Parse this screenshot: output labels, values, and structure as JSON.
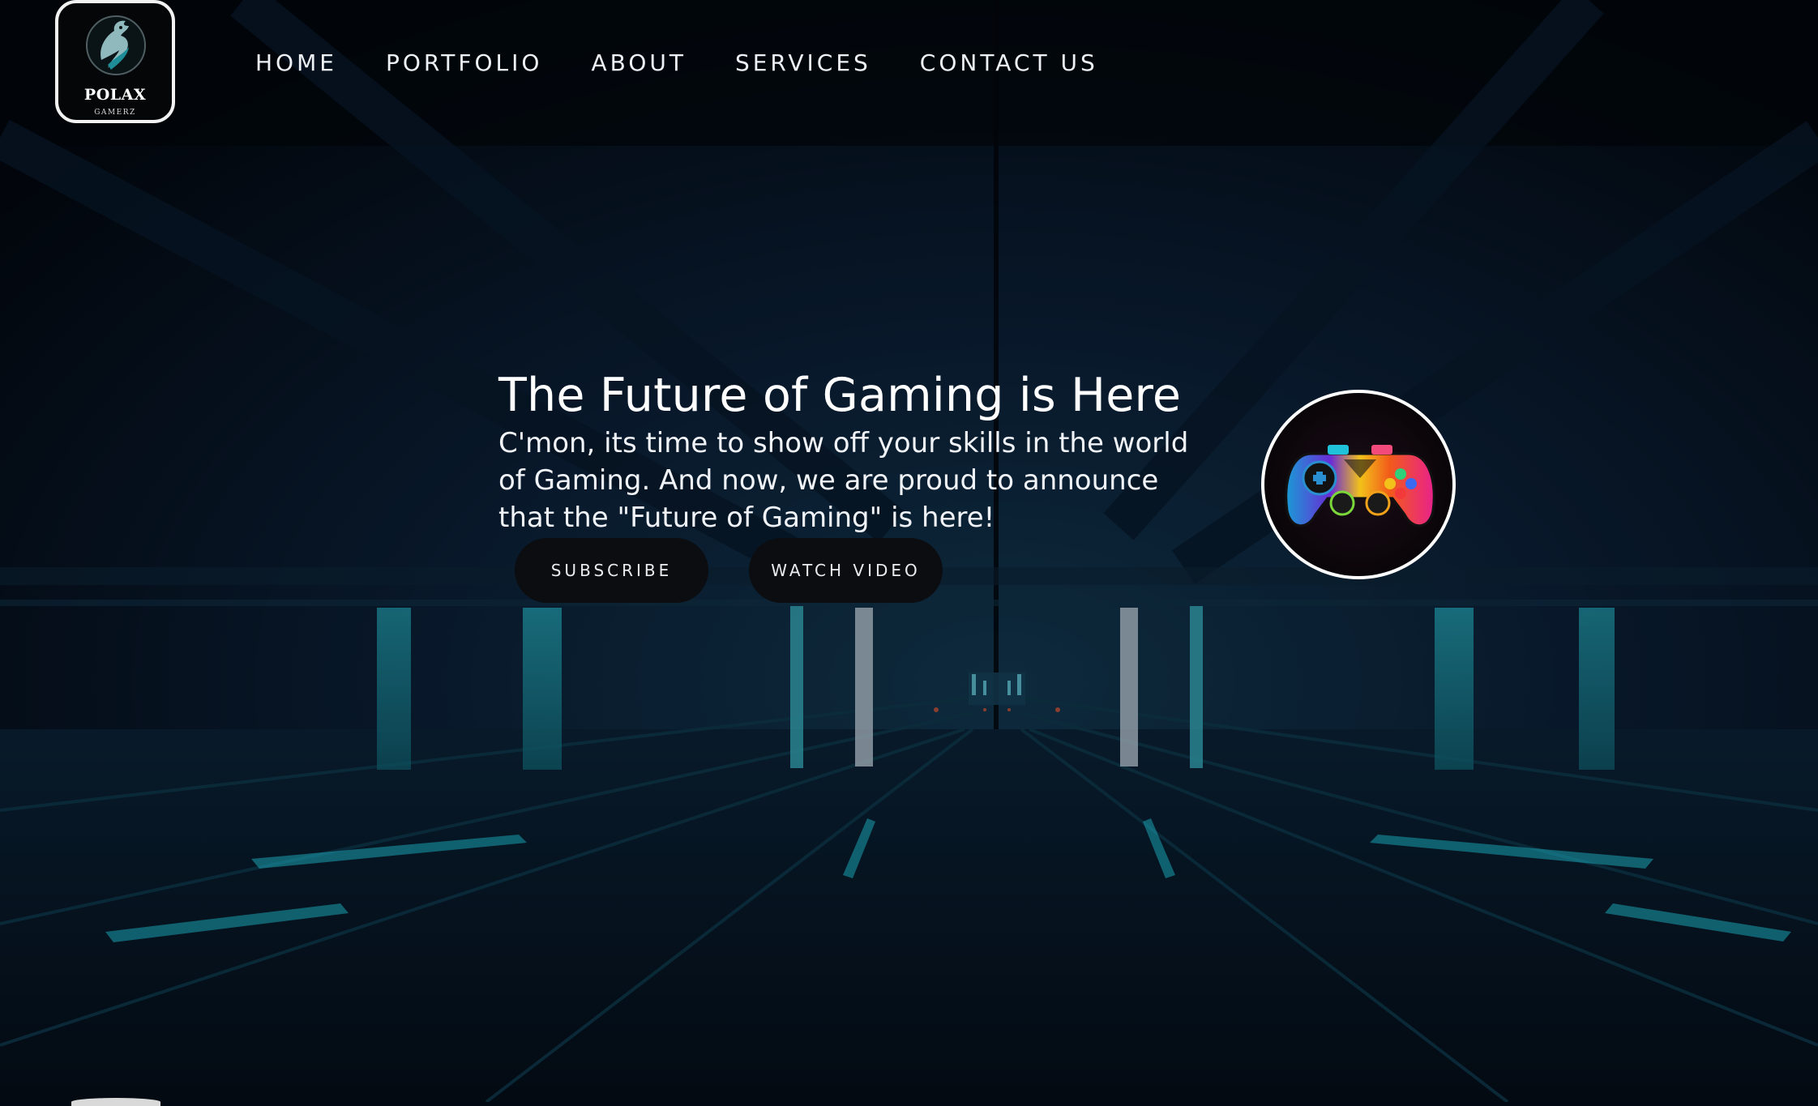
{
  "brand": {
    "name": "POLAX",
    "tagline": "GAMERZ",
    "icon": "dragon-logo-icon"
  },
  "nav": {
    "items": [
      {
        "label": "HOME"
      },
      {
        "label": "PORTFOLIO"
      },
      {
        "label": "ABOUT"
      },
      {
        "label": "SERVICES"
      },
      {
        "label": "CONTACT US"
      }
    ]
  },
  "hero": {
    "title": "The Future of Gaming is Here",
    "description": "C'mon, its time to show off your skills in the world of Gaming. And now, we are proud to announce that the \"Future of Gaming\" is here!",
    "buttons": {
      "subscribe": "SUBSCRIBE",
      "watch_video": "WATCH VIDEO"
    },
    "image_icon": "gamepad-controller-icon"
  },
  "colors": {
    "background": "#030912",
    "accent_teal": "#2fb7c4",
    "button_bg": "#0b0d10",
    "text": "#ffffff"
  }
}
